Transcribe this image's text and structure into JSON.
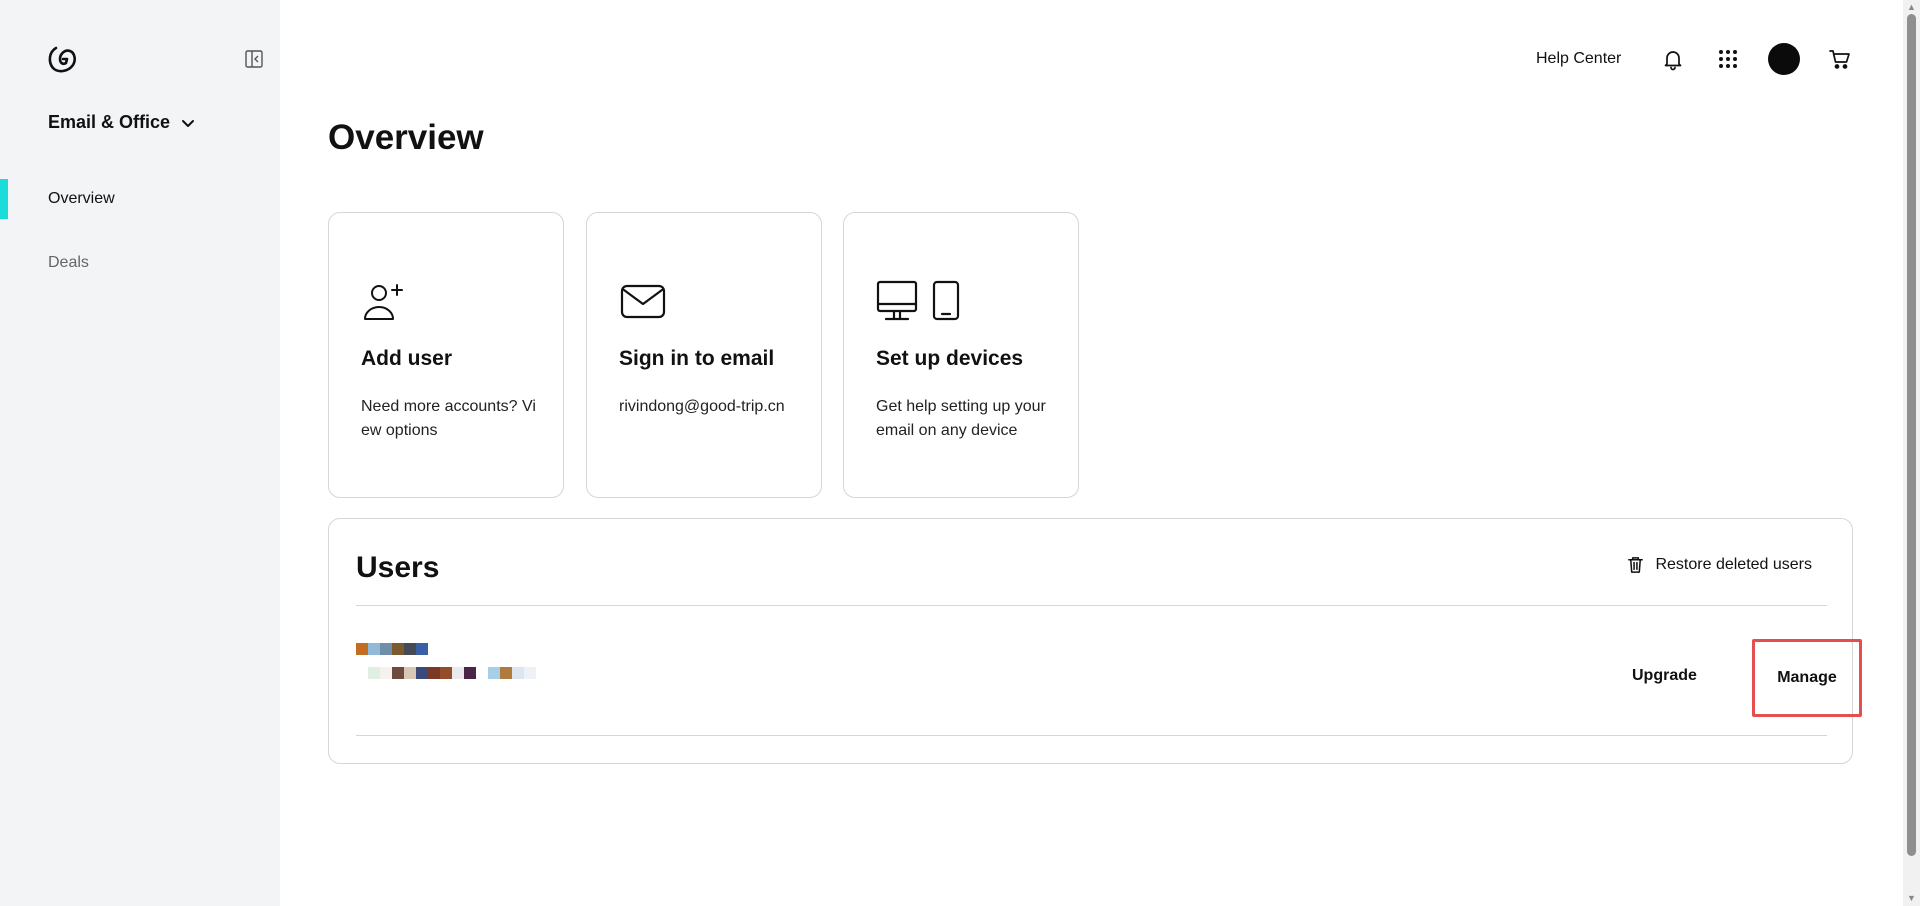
{
  "colors": {
    "accent": "#1bdbdb",
    "highlight_border": "#e54e4e",
    "sidebar_bg": "#f3f4f6"
  },
  "sidebar": {
    "logo_icon": "godaddy-logo-icon",
    "collapse_icon": "collapse-sidebar-icon",
    "product_switcher": {
      "label": "Email & Office",
      "icon": "chevron-down-icon"
    },
    "items": [
      {
        "label": "Overview",
        "active": true
      },
      {
        "label": "Deals",
        "active": false
      }
    ]
  },
  "header": {
    "help_label": "Help Center",
    "icons": [
      "bell-icon",
      "apps-grid-icon",
      "avatar",
      "cart-icon"
    ]
  },
  "main": {
    "title": "Overview",
    "cards": [
      {
        "icon": "add-user-icon",
        "title": "Add user",
        "description": "Need more accounts? View options"
      },
      {
        "icon": "mail-icon",
        "title": "Sign in to email",
        "description": "rivindong@good-trip.cn"
      },
      {
        "icon": "devices-icon",
        "title": "Set up devices",
        "description": "Get help setting up your email on any device"
      }
    ],
    "users": {
      "title": "Users",
      "restore_label": "Restore deleted users",
      "restore_icon": "trash-icon",
      "rows": [
        {
          "upgrade_label": "Upgrade",
          "manage_label": "Manage"
        }
      ]
    }
  }
}
